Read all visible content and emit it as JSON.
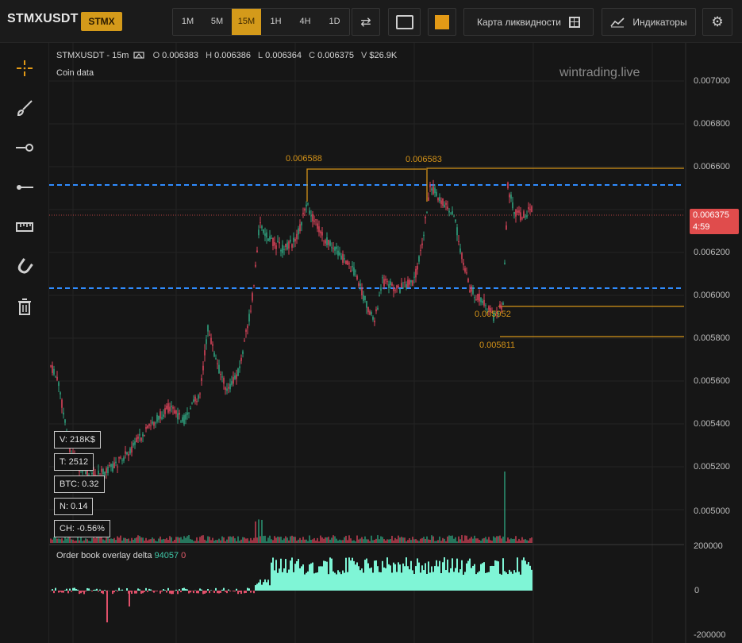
{
  "toolbar": {
    "symbol": "STMXUSDT",
    "coin_badge": "STMX",
    "timeframes": [
      "1M",
      "5M",
      "15M",
      "1H",
      "4H",
      "1D"
    ],
    "active_timeframe": "15M",
    "swap_icon": "⇄",
    "liquidity_map_label": "Карта ликвидности",
    "indicators_label": "Индикаторы",
    "settings_icon": "⚙"
  },
  "tools": [
    "crosshair-icon",
    "brush-icon",
    "ray-icon",
    "line-icon",
    "ruler-icon",
    "magnet-icon",
    "trash-icon"
  ],
  "legend": {
    "title": "STMXUSDT - 15m",
    "o_label": "O",
    "o": "0.006383",
    "h_label": "H",
    "h": "0.006386",
    "l_label": "L",
    "l": "0.006364",
    "c_label": "C",
    "c": "0.006375",
    "v_label": "V",
    "v": "$26.9K",
    "coin_data": "Coin data"
  },
  "watermark": "wintrading.live",
  "price_axis": [
    "0.007000",
    "0.006800",
    "0.006600",
    "0.006400",
    "0.006200",
    "0.006000",
    "0.005800",
    "0.005600",
    "0.005400",
    "0.005200",
    "0.005000"
  ],
  "delta_axis": [
    "200000",
    "0",
    "-200000"
  ],
  "current_price": {
    "price": "0.006375",
    "countdown": "4:59"
  },
  "annotations": {
    "high1": "0.006588",
    "high2": "0.006583",
    "low1": "0.005952",
    "low2": "0.005811"
  },
  "stats": [
    "V: 218K$",
    "T: 2512",
    "BTC: 0.32",
    "N: 0.14",
    "CH: -0.56%"
  ],
  "orderbook": {
    "title": "Order book overlay delta",
    "positive": "94057",
    "negative": "0"
  },
  "colors": {
    "accent": "#d49a1a",
    "up": "#2fa37f",
    "down": "#d9445a",
    "level_blue": "#2f8cff",
    "delta": "#7ff5d6"
  }
}
